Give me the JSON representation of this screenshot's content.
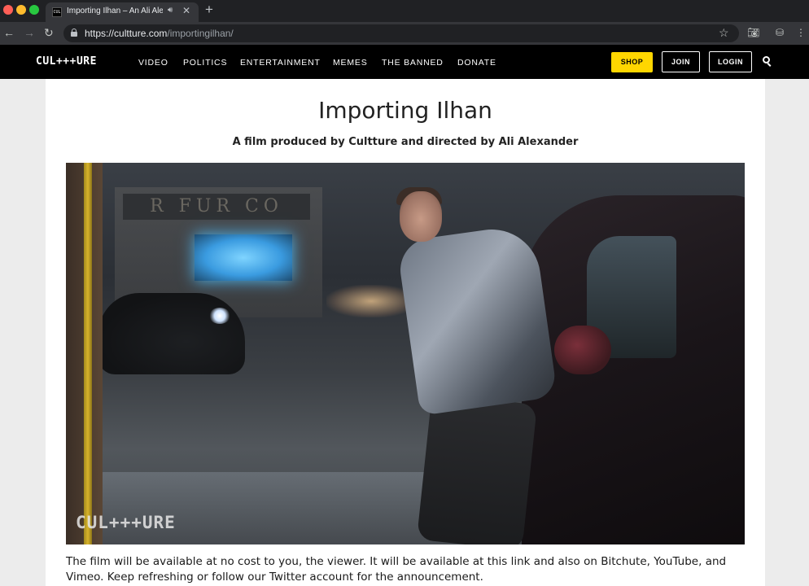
{
  "browser": {
    "tab": {
      "favicon_text": "CUL",
      "title": "Importing Ilhan – An Ali Alexander Film",
      "audio_icon": "speaker-icon",
      "close_glyph": "✕"
    },
    "new_tab_glyph": "+",
    "nav": {
      "back": "←",
      "forward": "→",
      "reload": "↻"
    },
    "url": {
      "host": "https://cultture.com",
      "path": "/importingilhan/"
    },
    "bookmark_glyph": "☆"
  },
  "site": {
    "logo": "CUL+++URE",
    "nav_items": [
      "VIDEO",
      "POLITICS",
      "ENTERTAINMENT",
      "MEMES",
      "THE BANNED",
      "DONATE"
    ],
    "shop_label": "SHOP",
    "join_label": "JOIN",
    "login_label": "LOGIN",
    "colors": {
      "accent": "#ffd600",
      "header_bg": "#000000"
    }
  },
  "page": {
    "title": "Importing Ilhan",
    "subtitle": "A film produced by Cultture and directed by Ali Alexander",
    "video_watermark": "CUL+++URE",
    "video_sign": "R FUR CO",
    "body": "The film will be available at no cost to you, the viewer. It will be available at this link and also on Bitchute, YouTube, and Vimeo. Keep refreshing or follow our Twitter account for the announcement."
  }
}
